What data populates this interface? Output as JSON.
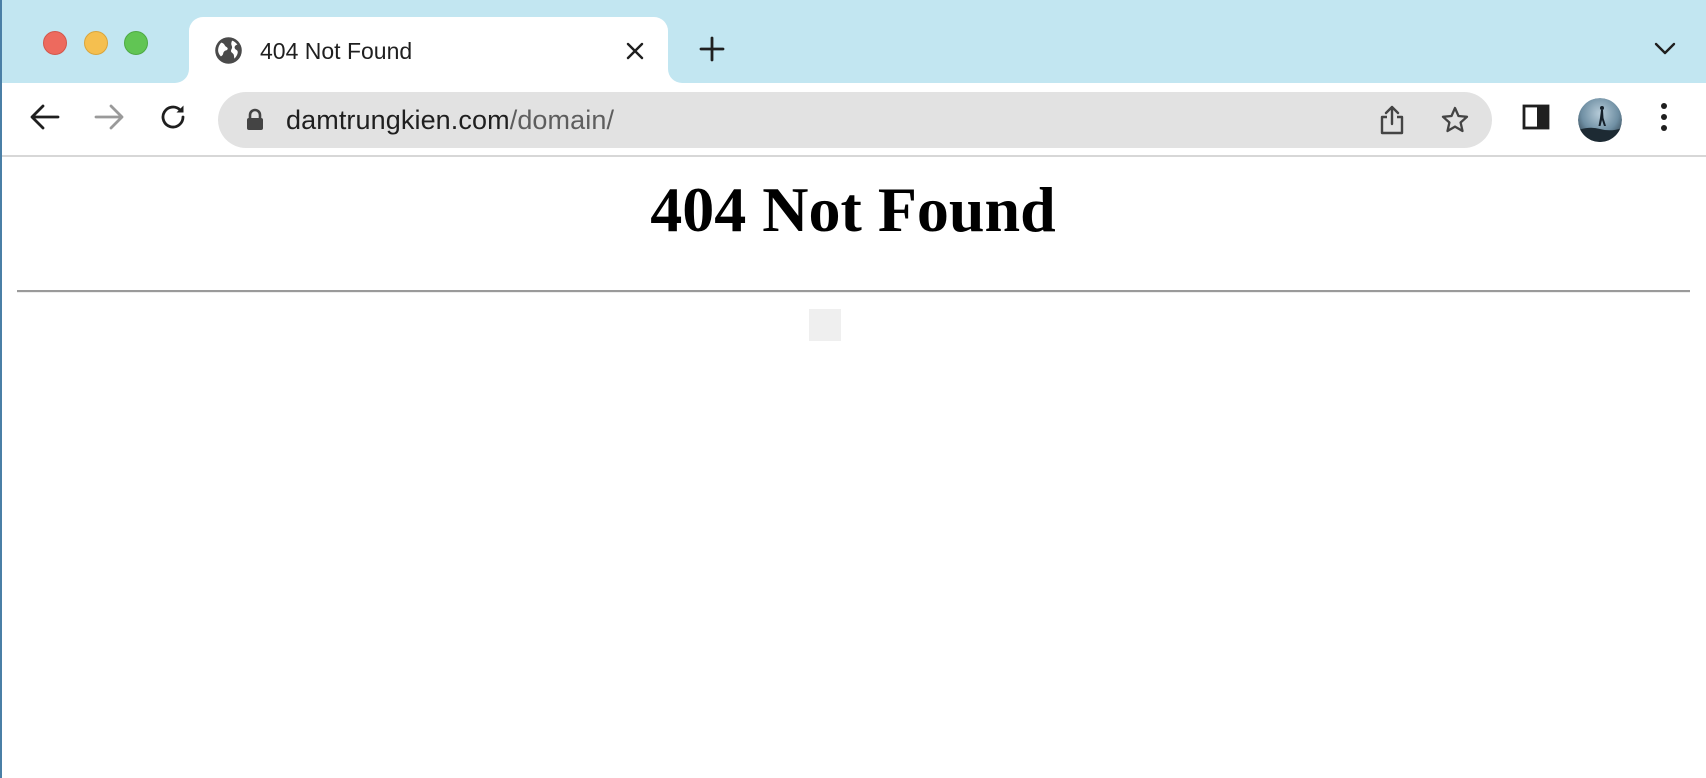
{
  "browser": {
    "tab": {
      "title": "404 Not Found",
      "favicon": "globe-icon",
      "close_icon": "close-icon"
    },
    "new_tab_icon": "plus-icon",
    "tab_search_icon": "chevron-down-icon",
    "toolbar": {
      "back_icon": "arrow-left-icon",
      "forward_icon": "arrow-right-icon",
      "reload_icon": "reload-icon",
      "sidepanel_icon": "side-panel-icon",
      "menu_icon": "kebab-menu-icon",
      "avatar": "profile-avatar"
    },
    "omnibox": {
      "host": "damtrungkien.com",
      "path": "/domain/",
      "lock_icon": "lock-icon",
      "share_icon": "share-icon",
      "bookmark_icon": "star-icon"
    }
  },
  "page": {
    "heading": "404 Not Found"
  },
  "colors": {
    "tabstrip_bg": "#c2e6f1",
    "omnibox_bg": "#e2e2e2",
    "traffic_red": "#ed6a5e",
    "traffic_yellow": "#f5bf4f",
    "traffic_green": "#61c554"
  }
}
